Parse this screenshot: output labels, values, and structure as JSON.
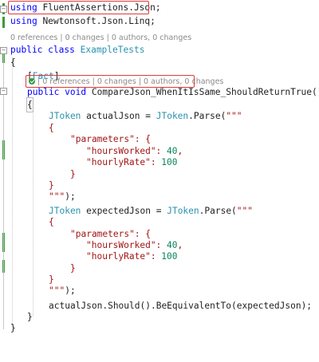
{
  "code": {
    "using1": {
      "kw": "using",
      "ns": "FluentAssertions.Json;"
    },
    "using2": {
      "kw": "using",
      "ns": "Newtonsoft.Json.Linq;"
    },
    "class_codelens": "0 references | 0 changes | 0 authors, 0 changes",
    "class_decl": {
      "kw1": "public",
      "kw2": "class",
      "name": "ExampleTests"
    },
    "open_brace": "{",
    "close_brace": "}",
    "attribute": {
      "open": "[",
      "name": "Fact",
      "close": "]"
    },
    "method_codelens": "| 0 references | 0 changes | 0 authors, 0 changes",
    "method_decl": {
      "kw1": "public",
      "kw2": "void",
      "name": "CompareJson_WhenItIsSame_ShouldReturnTrue()"
    },
    "actual": {
      "type": "JToken",
      "var": "actualJson = ",
      "cls": "JToken",
      "call": ".Parse(",
      "str_open": "\"\"\"",
      "lines": [
        "{",
        "\"parameters\": {",
        "\"hoursWorked\": ",
        "40",
        ",",
        "\"hourlyRate\": ",
        "100",
        "}",
        "}"
      ],
      "str_close": "\"\"\"",
      "end": ");"
    },
    "expected": {
      "type": "JToken",
      "var": "expectedJson = ",
      "cls": "JToken",
      "call": ".Parse(",
      "str_open": "\"\"\"",
      "lines": [
        "{",
        "\"parameters\": {",
        "\"hoursWorked\": ",
        "40",
        ",",
        "\"hourlyRate\": ",
        "100",
        "}",
        "}"
      ],
      "str_close": "\"\"\"",
      "end": ");"
    },
    "assert_line": "actualJson.Should().BeEquivalentTo(expectedJson);"
  },
  "colors": {
    "highlight": "#e03a3a",
    "change_bar": "#3c9a3c",
    "check": "#2f9e44"
  }
}
